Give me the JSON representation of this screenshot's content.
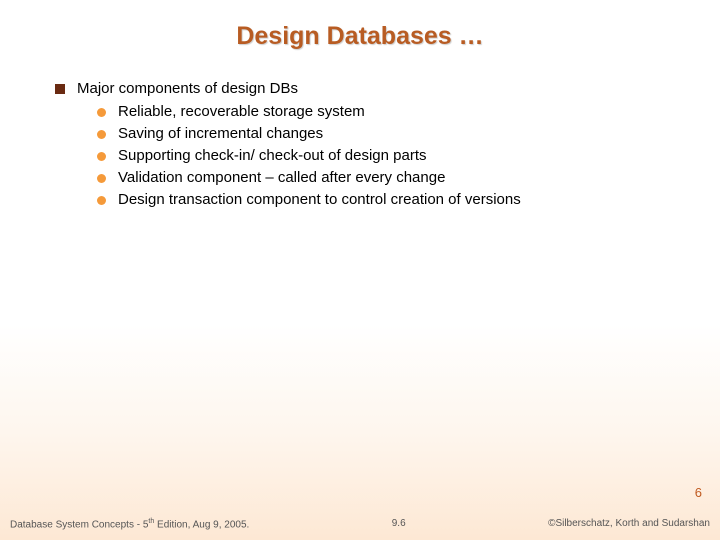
{
  "title": "Design Databases …",
  "main": {
    "heading": "Major components of design DBs",
    "items": [
      "Reliable, recoverable storage system",
      "Saving of incremental changes",
      "Supporting check-in/ check-out of design parts",
      "Validation component – called after every change",
      "Design transaction component to control creation of versions"
    ]
  },
  "page_badge": "6",
  "footer": {
    "left_a": "Database System Concepts - 5",
    "left_sup": "th",
    "left_b": " Edition, Aug 9, 2005.",
    "center": "9.6",
    "right": "©Silberschatz, Korth and Sudarshan"
  }
}
